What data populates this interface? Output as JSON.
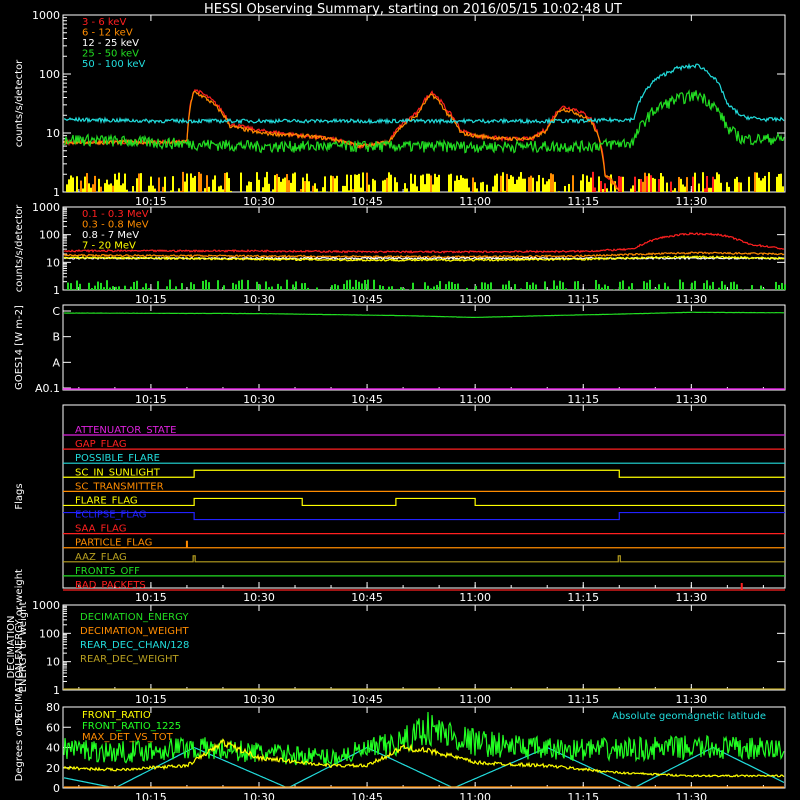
{
  "chart_data": {
    "type": "line",
    "title": "HESSI Observing Summary, starting on 2016/05/15 10:02:48 UT",
    "time_axis": {
      "start": "10:02:48",
      "end": "11:43",
      "tick_labels": [
        "10:15",
        "10:30",
        "10:45",
        "11:00",
        "11:15",
        "11:30"
      ],
      "tick_times": [
        "10:15",
        "10:30",
        "10:45",
        "11:00",
        "11:15",
        "11:30"
      ]
    },
    "panels": [
      {
        "id": "low-energy",
        "ylabel": "counts/s/detector",
        "yscale": "log",
        "ylim": [
          1,
          1000
        ],
        "ytick_labels": [
          "1",
          "10",
          "100",
          "1000"
        ],
        "series": [
          {
            "name": "3 - 6 keV",
            "color": "#ff2020",
            "t": [
              "10:03",
              "10:20",
              "10:21",
              "10:23",
              "10:26",
              "10:30",
              "10:36",
              "10:40",
              "10:44",
              "10:48",
              "10:52",
              "10:54",
              "10:56",
              "10:58",
              "11:00",
              "11:04",
              "11:08",
              "11:10",
              "11:12",
              "11:14",
              "11:16",
              "11:18",
              "11:20"
            ],
            "values": [
              7,
              7,
              55,
              40,
              14,
              11,
              9,
              8,
              6,
              7,
              22,
              50,
              25,
              11,
              9,
              8,
              8,
              12,
              28,
              25,
              18,
              2,
              1
            ]
          },
          {
            "name": "6 - 12 keV",
            "color": "#ff8c00",
            "t": [
              "10:03",
              "10:20",
              "10:21",
              "10:23",
              "10:26",
              "10:30",
              "10:36",
              "10:40",
              "10:44",
              "10:48",
              "10:52",
              "10:54",
              "10:56",
              "10:58",
              "11:00",
              "11:04",
              "11:08",
              "11:10",
              "11:12",
              "11:14",
              "11:16",
              "11:18",
              "11:20"
            ],
            "values": [
              7,
              7,
              50,
              36,
              13,
              10,
              9,
              8,
              6,
              7,
              20,
              45,
              22,
              10,
              9,
              8,
              8,
              11,
              26,
              22,
              16,
              2,
              1
            ]
          },
          {
            "name": "12 - 25 keV",
            "color": "#ffffff",
            "t": [
              "10:03",
              "10:20",
              "10:30",
              "10:45",
              "11:00",
              "11:15",
              "11:20"
            ],
            "values": [
              6,
              6,
              6,
              6,
              6,
              6,
              6
            ]
          },
          {
            "name": "25 - 50 keV",
            "color": "#22dd22",
            "t": [
              "10:03",
              "10:15",
              "10:30",
              "10:45",
              "11:00",
              "11:15",
              "11:22",
              "11:25",
              "11:28",
              "11:31",
              "11:33",
              "11:35",
              "11:37",
              "11:40",
              "11:43"
            ],
            "values": [
              8,
              7,
              6,
              6,
              6,
              6,
              7,
              25,
              38,
              45,
              30,
              12,
              8,
              8,
              8
            ]
          },
          {
            "name": "50 - 100 keV",
            "color": "#22dddd",
            "t": [
              "10:03",
              "10:15",
              "10:30",
              "10:45",
              "11:00",
              "11:15",
              "11:22",
              "11:25",
              "11:28",
              "11:31",
              "11:33",
              "11:35",
              "11:37",
              "11:40",
              "11:43"
            ],
            "values": [
              17,
              16,
              16,
              16,
              16,
              16,
              17,
              80,
              125,
              140,
              90,
              30,
              19,
              17,
              17
            ]
          }
        ]
      },
      {
        "id": "high-energy",
        "ylabel": "counts/s/detector",
        "yscale": "log",
        "ylim": [
          1,
          1000
        ],
        "ytick_labels": [
          "1",
          "10",
          "100",
          "1000"
        ],
        "series": [
          {
            "name": "0.1 - 0.3 MeV",
            "color": "#ff2020",
            "t": [
              "10:03",
              "10:30",
              "10:45",
              "11:00",
              "11:15",
              "11:22",
              "11:26",
              "11:30",
              "11:34",
              "11:38",
              "11:43"
            ],
            "values": [
              26,
              26,
              24,
              24,
              25,
              30,
              80,
              110,
              100,
              45,
              30
            ]
          },
          {
            "name": "0.3 - 0.8 MeV",
            "color": "#ff8c00",
            "t": [
              "10:03",
              "10:30",
              "10:45",
              "11:00",
              "11:15",
              "11:30",
              "11:43"
            ],
            "values": [
              18,
              17,
              16,
              16,
              17,
              22,
              20
            ]
          },
          {
            "name": "0.8 - 7 MeV",
            "color": "#ffffff",
            "t": [
              "10:03",
              "11:43"
            ],
            "values": [
              14,
              14
            ]
          },
          {
            "name": "7 - 20 MeV",
            "color": "#ffff00",
            "t": [
              "10:03",
              "10:30",
              "10:45",
              "11:00",
              "11:15",
              "11:30",
              "11:43"
            ],
            "values": [
              15,
              13,
              12,
              12,
              13,
              16,
              14
            ]
          }
        ]
      },
      {
        "id": "goes",
        "ylabel": "GOES14 [W m-2]",
        "ytick_labels": [
          "A0.1",
          "A",
          "B",
          "C"
        ],
        "series": [
          {
            "name": "GOES",
            "color": "#22dd22",
            "t": [
              "10:03",
              "10:30",
              "10:50",
              "11:00",
              "11:10",
              "11:20",
              "11:30",
              "11:43"
            ],
            "values": [
              2.92,
              2.9,
              2.82,
              2.75,
              2.82,
              2.88,
              2.95,
              2.93
            ]
          }
        ]
      },
      {
        "id": "flags",
        "ylabel": "Flags",
        "flags": [
          {
            "name": "ATTENUATOR_STATE",
            "color": "#dd22dd"
          },
          {
            "name": "GAP_FLAG",
            "color": "#ff2020"
          },
          {
            "name": "POSSIBLE_FLARE",
            "color": "#22dddd"
          },
          {
            "name": "SC_IN_SUNLIGHT",
            "color": "#ffff00"
          },
          {
            "name": "SC_TRANSMITTER",
            "color": "#ff8c00"
          },
          {
            "name": "FLARE_FLAG",
            "color": "#ffff00"
          },
          {
            "name": "ECLIPSE_FLAG",
            "color": "#2222ff"
          },
          {
            "name": "SAA_FLAG",
            "color": "#ff2020"
          },
          {
            "name": "PARTICLE_FLAG",
            "color": "#ff8c00"
          },
          {
            "name": "AAZ_FLAG",
            "color": "#b8a020"
          },
          {
            "name": "FRONTS_OFF",
            "color": "#22dd22"
          },
          {
            "name": "BAD_PACKETS",
            "color": "#ff2020"
          }
        ]
      },
      {
        "id": "decimation",
        "ylabel": "DECIMATION ENERGY or weight",
        "yscale": "log",
        "ylim": [
          1,
          1000
        ],
        "ytick_labels": [
          "1",
          "10",
          "100",
          "1000"
        ],
        "series": [
          {
            "name": "DECIMATION_ENERGY",
            "color": "#22dd22"
          },
          {
            "name": "DECIMATION_WEIGHT",
            "color": "#ff8c00"
          },
          {
            "name": "REAR_DEC_CHAN/128",
            "color": "#22dddd"
          },
          {
            "name": "REAR_DEC_WEIGHT",
            "color": "#b8a020"
          }
        ]
      },
      {
        "id": "ratios",
        "ylabel": "Degrees or %",
        "ylim": [
          0,
          80
        ],
        "ytick_labels": [
          "0",
          "20",
          "40",
          "60",
          "80"
        ],
        "annotation": "Absolute geomagnetic latitude",
        "annotation_color": "#22dddd",
        "series": [
          {
            "name": "FRONT_RATIO",
            "color": "#ffff00",
            "t": [
              "10:03",
              "10:10",
              "10:20",
              "10:25",
              "10:30",
              "10:40",
              "10:45",
              "10:50",
              "10:55",
              "11:00",
              "11:10",
              "11:20",
              "11:30",
              "11:43"
            ],
            "values": [
              20,
              18,
              22,
              45,
              30,
              22,
              22,
              40,
              35,
              25,
              22,
              15,
              12,
              12
            ]
          },
          {
            "name": "FRONT_RATIO_1225",
            "color": "#22ff22",
            "t": [
              "10:03",
              "10:10",
              "10:20",
              "10:30",
              "10:40",
              "10:50",
              "10:53",
              "11:00",
              "11:10",
              "11:20",
              "11:30",
              "11:43"
            ],
            "values": [
              40,
              35,
              40,
              35,
              30,
              45,
              60,
              45,
              38,
              38,
              40,
              38
            ]
          },
          {
            "name": "MAX_DET_VS_TOT",
            "color": "#ff8c00",
            "t": [
              "10:03",
              "11:43"
            ],
            "values": [
              0,
              0
            ]
          },
          {
            "name": "Absolute geomagnetic latitude",
            "color": "#22dddd",
            "t": [
              "10:03",
              "10:10",
              "10:21",
              "10:34",
              "10:45",
              "10:57",
              "11:10",
              "11:22",
              "11:33",
              "11:43"
            ],
            "values": [
              10,
              0,
              40,
              0,
              40,
              0,
              40,
              0,
              40,
              5
            ]
          }
        ]
      }
    ]
  }
}
